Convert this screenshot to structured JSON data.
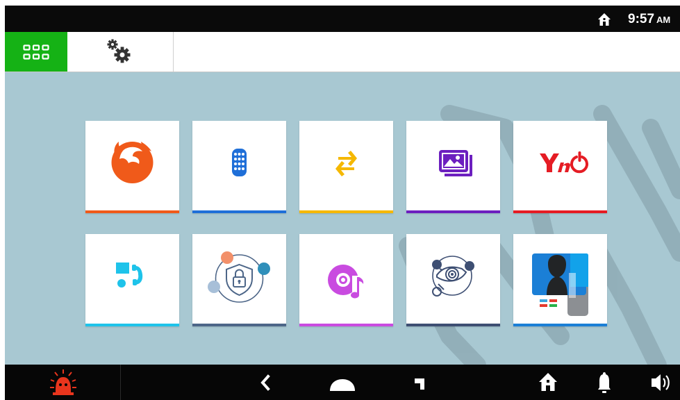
{
  "status_bar": {
    "time": "9:57",
    "ampm": "AM",
    "home_icon": "home-icon"
  },
  "top_bar": {
    "tabs": [
      {
        "name": "apps",
        "icon": "app-grid-icon",
        "active": true,
        "color": "#15b215"
      },
      {
        "name": "settings",
        "icon": "gears-icon",
        "active": false
      }
    ]
  },
  "apps": [
    {
      "id": "firefox",
      "icon": "firefox-icon",
      "accent": "#f05a1a"
    },
    {
      "id": "remote",
      "icon": "remote-control-icon",
      "accent": "#1f6fd8"
    },
    {
      "id": "transfer",
      "icon": "transfer-arrows-icon",
      "accent": "#f5b800"
    },
    {
      "id": "gallery",
      "icon": "image-gallery-icon",
      "accent": "#6c1fbf"
    },
    {
      "id": "yno",
      "icon": "yno-logo",
      "logo_text": "YnO",
      "accent": "#e51c24"
    },
    {
      "id": "intercom",
      "icon": "intercom-icon",
      "accent": "#1ec3ea"
    },
    {
      "id": "security",
      "icon": "security-lock-icon",
      "accent": "#4d6688"
    },
    {
      "id": "music",
      "icon": "music-disc-icon",
      "accent": "#c94be0"
    },
    {
      "id": "surveillance",
      "icon": "eye-orbit-icon",
      "accent": "#3e4f73"
    },
    {
      "id": "contacts",
      "icon": "contacts-icon",
      "accent": "#1b7fd6"
    }
  ],
  "nav_bar": {
    "items": [
      "alarm-icon",
      "back-icon",
      "home-button-icon",
      "recents-icon",
      "home-icon",
      "bell-icon",
      "volume-icon"
    ],
    "alarm_color": "#e8351d"
  }
}
